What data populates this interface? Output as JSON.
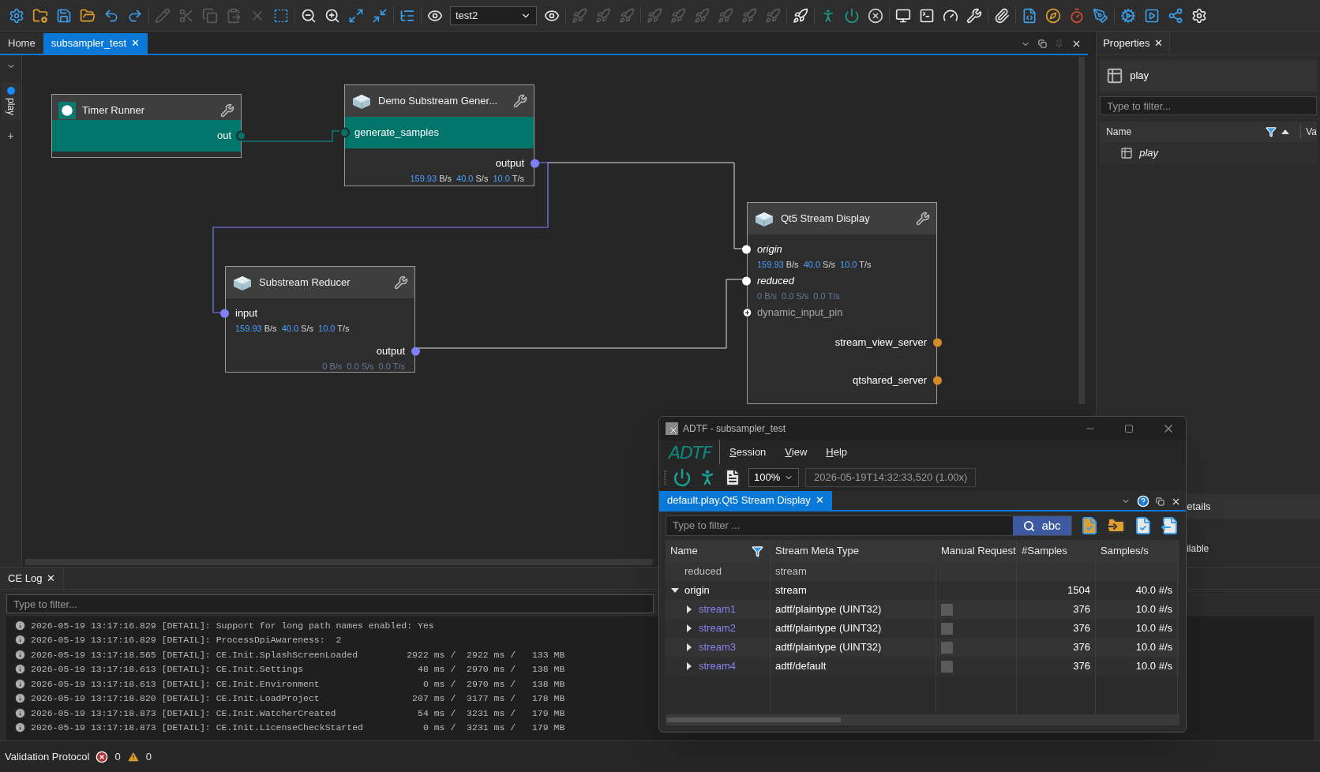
{
  "toolbar": {
    "groups": [
      {
        "items": [
          {
            "kind": "gear",
            "disabled": false
          },
          {
            "kind": "folder-gear",
            "disabled": false
          },
          {
            "kind": "save",
            "disabled": false
          },
          {
            "kind": "folder",
            "disabled": false
          },
          {
            "kind": "undo",
            "disabled": false
          },
          {
            "kind": "redo",
            "disabled": false
          }
        ]
      },
      {
        "items": [
          {
            "kind": "pencil",
            "disabled": true
          },
          {
            "kind": "scissors",
            "disabled": true
          },
          {
            "kind": "copy",
            "disabled": true
          },
          {
            "kind": "paste",
            "disabled": true
          },
          {
            "kind": "delete",
            "disabled": true
          },
          {
            "kind": "select",
            "disabled": false
          }
        ]
      },
      {
        "items": [
          {
            "kind": "zoom-out",
            "disabled": false
          },
          {
            "kind": "zoom-in",
            "disabled": false
          },
          {
            "kind": "expand",
            "disabled": false
          },
          {
            "kind": "shrink",
            "disabled": false
          }
        ]
      },
      {
        "items": [
          {
            "kind": "tree",
            "disabled": false
          }
        ]
      },
      {
        "items": [
          {
            "kind": "eye",
            "disabled": false
          },
          {
            "kind": "dropdown",
            "value": "test2"
          },
          {
            "kind": "eye",
            "disabled": false
          }
        ]
      },
      {
        "items": [
          {
            "kind": "rocket",
            "disabled": true
          },
          {
            "kind": "rocket",
            "disabled": true
          },
          {
            "kind": "rocket",
            "disabled": true
          }
        ]
      },
      {
        "items": [
          {
            "kind": "rocket",
            "disabled": true
          },
          {
            "kind": "rocket",
            "disabled": true
          },
          {
            "kind": "rocket",
            "disabled": true
          },
          {
            "kind": "rocket",
            "disabled": true
          },
          {
            "kind": "rocket",
            "disabled": true
          },
          {
            "kind": "rocket",
            "disabled": true
          }
        ]
      },
      {
        "items": [
          {
            "kind": "rocket",
            "disabled": false
          }
        ]
      },
      {
        "items": [
          {
            "kind": "runner",
            "disabled": false
          },
          {
            "kind": "power",
            "disabled": false
          },
          {
            "kind": "cancel",
            "disabled": false
          }
        ]
      },
      {
        "items": [
          {
            "kind": "monitor",
            "disabled": false
          },
          {
            "kind": "console",
            "disabled": false
          },
          {
            "kind": "gauge",
            "disabled": false
          },
          {
            "kind": "wrench",
            "disabled": false
          }
        ]
      },
      {
        "items": [
          {
            "kind": "paperclip",
            "disabled": false
          }
        ]
      },
      {
        "items": [
          {
            "kind": "ddl",
            "disabled": false
          },
          {
            "kind": "compass",
            "disabled": false
          },
          {
            "kind": "timer",
            "disabled": false
          },
          {
            "kind": "pen",
            "disabled": false
          }
        ]
      },
      {
        "items": [
          {
            "kind": "cogs",
            "disabled": false
          },
          {
            "kind": "play",
            "disabled": false
          },
          {
            "kind": "share",
            "disabled": false
          },
          {
            "kind": "settings",
            "disabled": false
          }
        ]
      }
    ]
  },
  "tabs": [
    {
      "label": "Home",
      "selected": false
    },
    {
      "label": "subsampler_test",
      "selected": true,
      "close": "✕"
    }
  ],
  "side_tabs": [
    {
      "label": "play",
      "selected": true
    }
  ],
  "side_add": "+",
  "graph": {
    "nodes": [
      {
        "title": "Timer Runner",
        "kind": "timer",
        "pins": [
          {
            "name": "out",
            "outgoing": true,
            "kind": "trigger"
          }
        ]
      },
      {
        "title": "Demo Substream Gener...",
        "kind": "filter",
        "pins": [
          {
            "name": "generate_samples",
            "outgoing": false,
            "kind": "trigger"
          },
          {
            "name": "output",
            "outgoing": true,
            "kind": "data",
            "stats": {
              "active": true,
              "values": [
                {
                  "value": "159.93",
                  "unit": "B/s"
                },
                {
                  "value": "40.0",
                  "unit": "S/s"
                },
                {
                  "value": "10.0",
                  "unit": "T/s"
                }
              ]
            }
          }
        ]
      },
      {
        "title": "Substream Reducer",
        "kind": "filter",
        "pins": [
          {
            "name": "input",
            "outgoing": false,
            "kind": "data",
            "stats": {
              "active": true,
              "values": [
                {
                  "value": "159.93",
                  "unit": "B/s"
                },
                {
                  "value": "40.0",
                  "unit": "S/s"
                },
                {
                  "value": "10.0",
                  "unit": "T/s"
                }
              ]
            }
          },
          {
            "name": "output",
            "outgoing": true,
            "kind": "data",
            "stats": {
              "active": false,
              "values": [
                {
                  "value": "0",
                  "unit": "B/s"
                },
                {
                  "value": "0.0",
                  "unit": "S/s"
                },
                {
                  "value": "0.0",
                  "unit": "T/s"
                }
              ]
            }
          }
        ]
      },
      {
        "title": "Qt5 Stream Display",
        "kind": "filter",
        "pins": [
          {
            "name": "origin",
            "outgoing": false,
            "kind": "display",
            "stats": {
              "active": true,
              "values": [
                {
                  "value": "159.93",
                  "unit": "B/s"
                },
                {
                  "value": "40.0",
                  "unit": "S/s"
                },
                {
                  "value": "10.0",
                  "unit": "T/s"
                }
              ]
            }
          },
          {
            "name": "reduced",
            "outgoing": false,
            "kind": "display",
            "stats": {
              "active": false,
              "values": [
                {
                  "value": "0",
                  "unit": "B/s"
                },
                {
                  "value": "0.0",
                  "unit": "S/s"
                },
                {
                  "value": "0.0",
                  "unit": "T/s"
                }
              ]
            }
          },
          {
            "name": "dynamic_input_pin",
            "kind": "dynamic"
          },
          {
            "name": "stream_view_server",
            "outgoing": true,
            "kind": "server"
          },
          {
            "name": "qtshared_server",
            "outgoing": true,
            "kind": "server"
          }
        ]
      }
    ]
  },
  "properties": {
    "tab": "Properties",
    "close": "✕",
    "object": "play",
    "filter_placeholder": "Type to filter...",
    "columns": [
      "Name",
      "Va"
    ],
    "tree": [
      {
        "label": "play"
      }
    ],
    "section": "etails",
    "note": "ilable"
  },
  "log": {
    "tab": "CE Log",
    "close": "✕",
    "filter_placeholder": "Type to filter...",
    "lines": [
      "2026-05-19 13:17:16.829 [DETAIL]: Support for long path names enabled: Yes",
      "2026-05-19 13:17:16.829 [DETAIL]: ProcessDpiAwareness:  2",
      "2026-05-19 13:17:18.565 [DETAIL]: CE.Init.SplashScreenLoaded         2922 ms /  2922 ms /   133 MB",
      "2026-05-19 13:17:18.613 [DETAIL]: CE.Init.Settings                     48 ms /  2970 ms /   138 MB",
      "2026-05-19 13:17:18.613 [DETAIL]: CE.Init.Environment                   0 ms /  2970 ms /   138 MB",
      "2026-05-19 13:17:18.820 [DETAIL]: CE.Init.LoadProject                 207 ms /  3177 ms /   178 MB",
      "2026-05-19 13:17:18.873 [DETAIL]: CE.Init.WatcherCreated               54 ms /  3231 ms /   179 MB",
      "2026-05-19 13:17:18.873 [DETAIL]: CE.Init.LicenseCheckStarted           0 ms /  3231 ms /   179 MB"
    ]
  },
  "status_bar": {
    "label": "Validation Protocol",
    "errors": "0",
    "warnings": "0"
  },
  "session_window": {
    "title": "ADTF - subsampler_test",
    "logo": "ADTF",
    "menu": [
      "Session",
      "View",
      "Help"
    ],
    "zoom": "100%",
    "timestamp": "2026-05-19T14:32:33,520 (1.00x)",
    "tab": "default.play.Qt5 Stream Display",
    "tab_close": "✕",
    "filter_placeholder": "Type to filter ...",
    "search_button": "abc",
    "columns": [
      "Name",
      "Stream Meta Type",
      "Manual Request",
      "#Samples",
      "Samples/s"
    ],
    "rows": [
      {
        "name": "reduced",
        "type": "stream",
        "active": false
      },
      {
        "name": "origin",
        "type": "stream",
        "active": true,
        "expanded": true,
        "samples": "1504",
        "rate": "40.0 #/s",
        "children": [
          {
            "name": "stream1",
            "type": "adtf/plaintype (UINT32)",
            "expanded": false,
            "manual_request": false,
            "samples": "376",
            "rate": "10.0 #/s"
          },
          {
            "name": "stream2",
            "type": "adtf/plaintype (UINT32)",
            "expanded": false,
            "manual_request": false,
            "samples": "376",
            "rate": "10.0 #/s"
          },
          {
            "name": "stream3",
            "type": "adtf/plaintype (UINT32)",
            "expanded": false,
            "manual_request": false,
            "samples": "376",
            "rate": "10.0 #/s"
          },
          {
            "name": "stream4",
            "type": "adtf/default",
            "expanded": false,
            "manual_request": false,
            "samples": "376",
            "rate": "10.0 #/s"
          }
        ]
      }
    ]
  }
}
